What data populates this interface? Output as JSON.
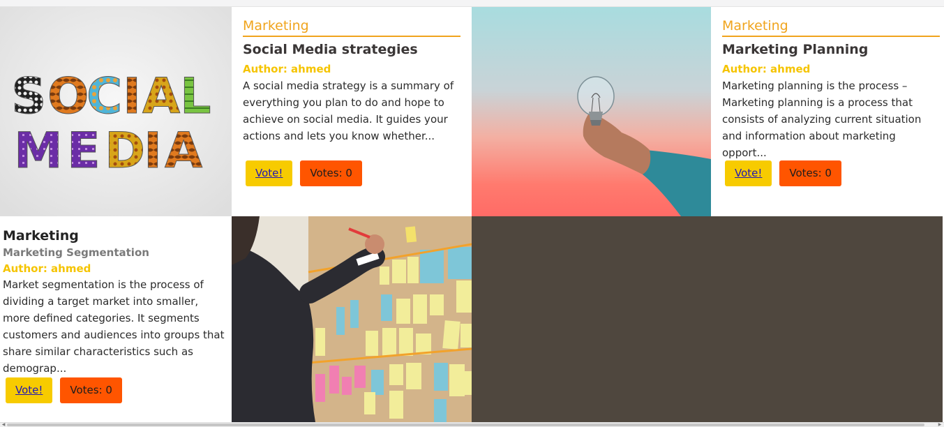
{
  "cards": [
    {
      "category": "Marketing",
      "title": "Social Media strategies",
      "author": "Author: ahmed",
      "description": "A social media strategy is a summary of everything you plan to do and hope to achieve on social media. It guides your actions and lets you know whether...",
      "vote_label": "Vote!",
      "votes_label": "Votes: 0",
      "image_text": {
        "line1": "SOCIAL",
        "line2": "MEDIA"
      }
    },
    {
      "category": "Marketing",
      "title": "Marketing Planning",
      "author": "Author: ahmed",
      "description": "Marketing planning is the process – Marketing planning is a process that consists of analyzing current situation and information about marketing opport...",
      "vote_label": "Vote!",
      "votes_label": "Votes: 0"
    },
    {
      "category": "Marketing",
      "title": "Marketing Segmentation",
      "author": "Author: ahmed",
      "description": "Market segmentation is the process of dividing a target market into smaller, more defined categories. It segments customers and audiences into groups that share similar characteristics such as demograp...",
      "vote_label": "Vote!",
      "votes_label": "Votes: 0"
    }
  ],
  "colors": {
    "category": "#f0a41d",
    "author": "#f5c400",
    "vote_button": "#f7cb00",
    "votes_button": "#ff5500",
    "empty_tile": "#4f473e"
  },
  "icons": [
    "chevron-left-icon",
    "chevron-right-icon"
  ]
}
